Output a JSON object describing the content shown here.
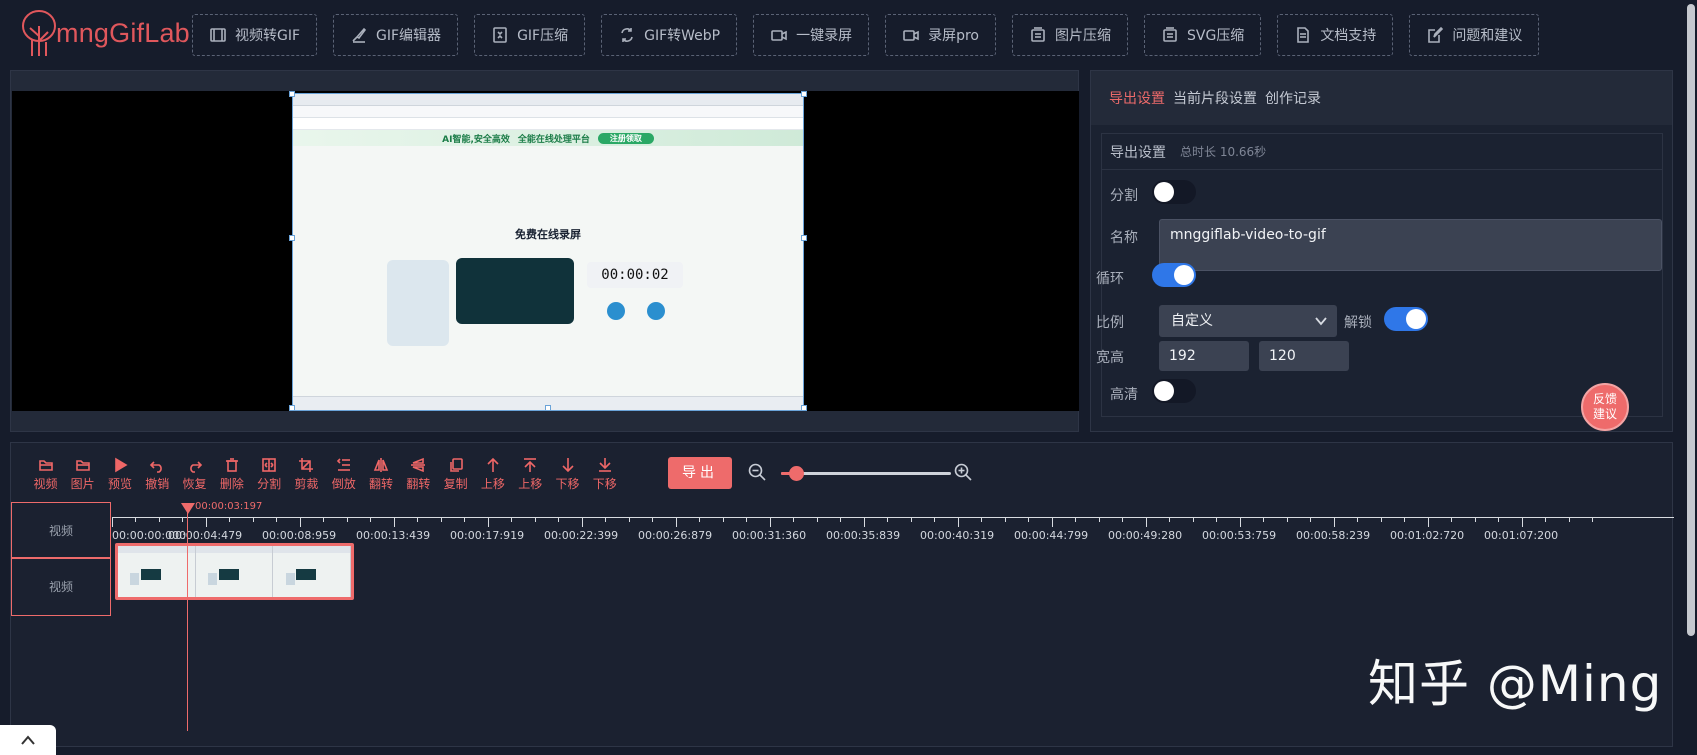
{
  "app": {
    "logo_text": "mngGifLab"
  },
  "nav": [
    {
      "label": "视频转GIF",
      "icon": "film-icon"
    },
    {
      "label": "GIF编辑器",
      "icon": "brush-icon"
    },
    {
      "label": "GIF压缩",
      "icon": "compress-icon"
    },
    {
      "label": "GIF转WebP",
      "icon": "convert-icon"
    },
    {
      "label": "一键录屏",
      "icon": "camera-icon"
    },
    {
      "label": "录屏pro",
      "icon": "camera-icon"
    },
    {
      "label": "图片压缩",
      "icon": "stack-icon"
    },
    {
      "label": "SVG压缩",
      "icon": "stack-icon"
    },
    {
      "label": "文档支持",
      "icon": "document-icon"
    },
    {
      "label": "问题和建议",
      "icon": "edit-icon"
    }
  ],
  "preview": {
    "banner_text": "AI智能,安全高效",
    "banner_center": "全能在线处理平台",
    "banner_pill": "注册领取",
    "page_title": "免费在线录屏",
    "timer": "00:00:02"
  },
  "settings": {
    "tabs": [
      "导出设置",
      "当前片段设置",
      "创作记录"
    ],
    "active_tab": 0,
    "box_title": "导出设置",
    "total_duration": "总时长 10.66秒",
    "split_label": "分割",
    "split_on": false,
    "name_label": "名称",
    "name_value": "mnggiflab-video-to-gif",
    "loop_label": "循环",
    "loop_on": true,
    "ratio_label": "比例",
    "ratio_value": "自定义",
    "unlock_label": "解锁",
    "unlock_on": true,
    "size_label": "宽高",
    "width": "192",
    "height": "120",
    "hd_label": "高清",
    "hd_on": false
  },
  "feedback": {
    "line1": "反馈",
    "line2": "建议"
  },
  "toolbar": [
    {
      "label": "视频",
      "icon": "folder-icon"
    },
    {
      "label": "图片",
      "icon": "folder-icon"
    },
    {
      "label": "预览",
      "icon": "play-icon"
    },
    {
      "label": "撤销",
      "icon": "undo-icon"
    },
    {
      "label": "恢复",
      "icon": "redo-icon"
    },
    {
      "label": "删除",
      "icon": "trash-icon"
    },
    {
      "label": "分割",
      "icon": "split-icon"
    },
    {
      "label": "剪裁",
      "icon": "crop-icon"
    },
    {
      "label": "倒放",
      "icon": "reverse-icon"
    },
    {
      "label": "翻转",
      "icon": "flip-h-icon"
    },
    {
      "label": "翻转",
      "icon": "flip-v-icon"
    },
    {
      "label": "复制",
      "icon": "copy-icon"
    },
    {
      "label": "上移",
      "icon": "arrow-up-icon"
    },
    {
      "label": "上移",
      "icon": "arrow-top-icon"
    },
    {
      "label": "下移",
      "icon": "arrow-down-icon"
    },
    {
      "label": "下移",
      "icon": "arrow-bottom-icon"
    }
  ],
  "export_label": "导出",
  "zoom_level": 0.05,
  "playhead": "00:00:03:197",
  "ruler_labels": [
    "00:00:00:000",
    "00:00:04:479",
    "00:00:08:959",
    "00:00:13:439",
    "00:00:17:919",
    "00:00:22:399",
    "00:00:26:879",
    "00:00:31:360",
    "00:00:35:839",
    "00:00:40:319",
    "00:00:44:799",
    "00:00:49:280",
    "00:00:53:759",
    "00:00:58:239",
    "00:01:02:720",
    "00:01:07:200"
  ],
  "tracks": [
    "视频",
    "视频"
  ],
  "watermark": "知乎 @Ming",
  "colors": {
    "accent": "#ee6b6b",
    "toggle_on": "#2f77e8",
    "bg": "#161c2b"
  }
}
